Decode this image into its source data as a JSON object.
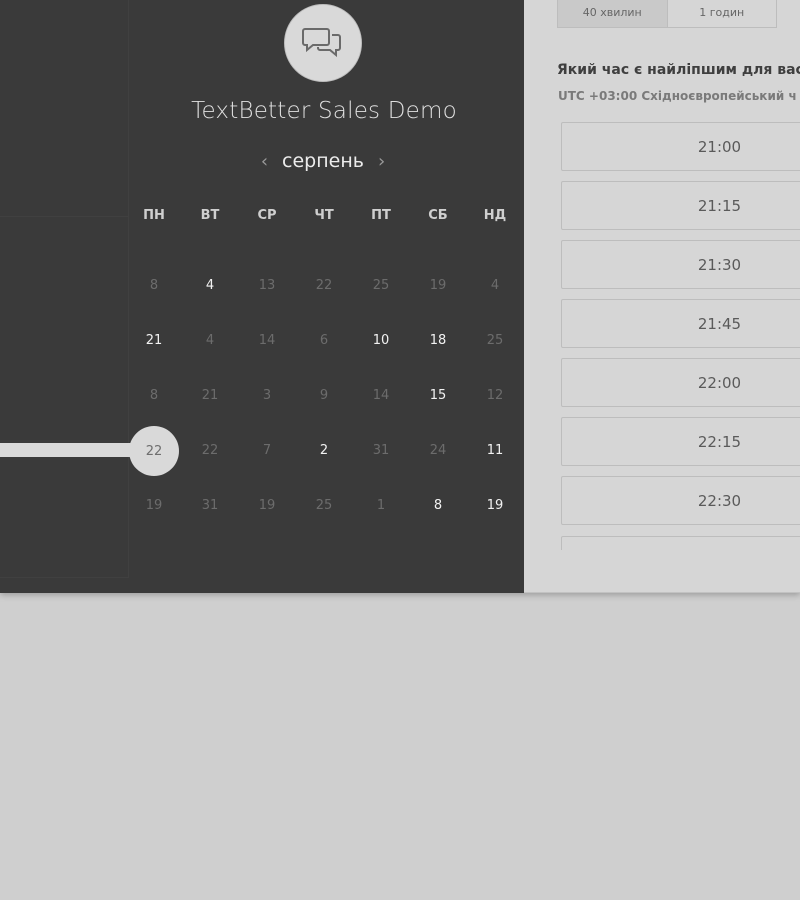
{
  "event": {
    "title": "TextBetter Sales Demo",
    "icon": "chat-bubbles-icon"
  },
  "calendar": {
    "month": "серпень",
    "prev_label": "‹",
    "next_label": "›",
    "weekdays": [
      "ПН",
      "ВТ",
      "СР",
      "ЧТ",
      "ПТ",
      "СБ",
      "НД"
    ],
    "rows": [
      [
        {
          "d": "8",
          "a": false
        },
        {
          "d": "4",
          "a": true
        },
        {
          "d": "13",
          "a": false
        },
        {
          "d": "22",
          "a": false
        },
        {
          "d": "25",
          "a": false
        },
        {
          "d": "19",
          "a": false
        },
        {
          "d": "4",
          "a": false
        }
      ],
      [
        {
          "d": "21",
          "a": true
        },
        {
          "d": "4",
          "a": false
        },
        {
          "d": "14",
          "a": false
        },
        {
          "d": "6",
          "a": false
        },
        {
          "d": "10",
          "a": true
        },
        {
          "d": "18",
          "a": true
        },
        {
          "d": "25",
          "a": false
        }
      ],
      [
        {
          "d": "8",
          "a": false
        },
        {
          "d": "21",
          "a": false
        },
        {
          "d": "3",
          "a": false
        },
        {
          "d": "9",
          "a": false
        },
        {
          "d": "14",
          "a": false
        },
        {
          "d": "15",
          "a": true
        },
        {
          "d": "12",
          "a": false
        }
      ],
      [
        {
          "d": "22",
          "a": false,
          "selected": true
        },
        {
          "d": "22",
          "a": false
        },
        {
          "d": "7",
          "a": false
        },
        {
          "d": "2",
          "a": true
        },
        {
          "d": "31",
          "a": false
        },
        {
          "d": "24",
          "a": false
        },
        {
          "d": "11",
          "a": true
        }
      ],
      [
        {
          "d": "19",
          "a": false
        },
        {
          "d": "31",
          "a": false
        },
        {
          "d": "19",
          "a": false
        },
        {
          "d": "25",
          "a": false
        },
        {
          "d": "1",
          "a": false
        },
        {
          "d": "8",
          "a": true
        },
        {
          "d": "19",
          "a": true
        }
      ]
    ]
  },
  "duration": {
    "options": [
      "40 хвилин",
      "1 годин"
    ],
    "selected": "40 хвилин"
  },
  "times": {
    "question": "Який час є найліпшим для вас",
    "timezone": "UTC +03:00 Східноєвропейський ч",
    "slots": [
      "21:00",
      "21:15",
      "21:30",
      "21:45",
      "22:00",
      "22:15",
      "22:30"
    ]
  },
  "colors": {
    "dark_panel": "#3a3a3a",
    "light_panel": "#d6d6d6",
    "background": "#cfcfcf"
  }
}
